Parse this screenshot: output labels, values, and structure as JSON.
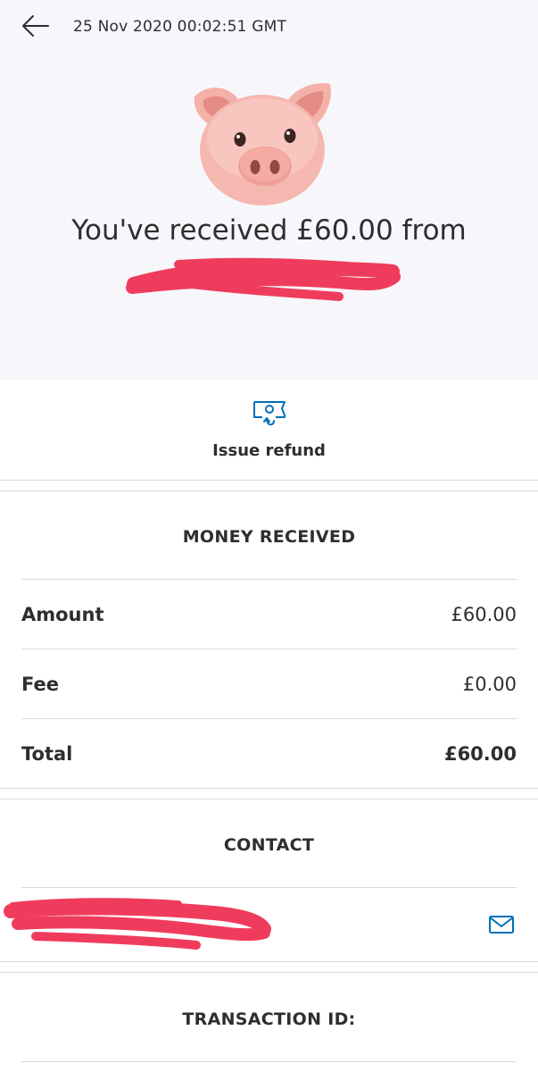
{
  "header": {
    "timestamp": "25 Nov 2020 00:02:51 GMT",
    "back_icon": "back-arrow-icon"
  },
  "hero": {
    "emoji": "pig-face",
    "message": "You've received £60.00 from"
  },
  "refund": {
    "icon": "refund-icon",
    "label": "Issue refund",
    "accent": "#0070ba"
  },
  "money_received": {
    "title": "MONEY RECEIVED",
    "rows": [
      {
        "label": "Amount",
        "value": "£60.00"
      },
      {
        "label": "Fee",
        "value": "£0.00"
      },
      {
        "label": "Total",
        "value": "£60.00"
      }
    ]
  },
  "contact": {
    "title": "CONTACT",
    "mail_icon": "mail-icon"
  },
  "transaction": {
    "title": "TRANSACTION ID:"
  },
  "colors": {
    "redaction": "#f03c5c",
    "hero_bg": "#f7f7fb",
    "icon_blue": "#0070ba"
  }
}
